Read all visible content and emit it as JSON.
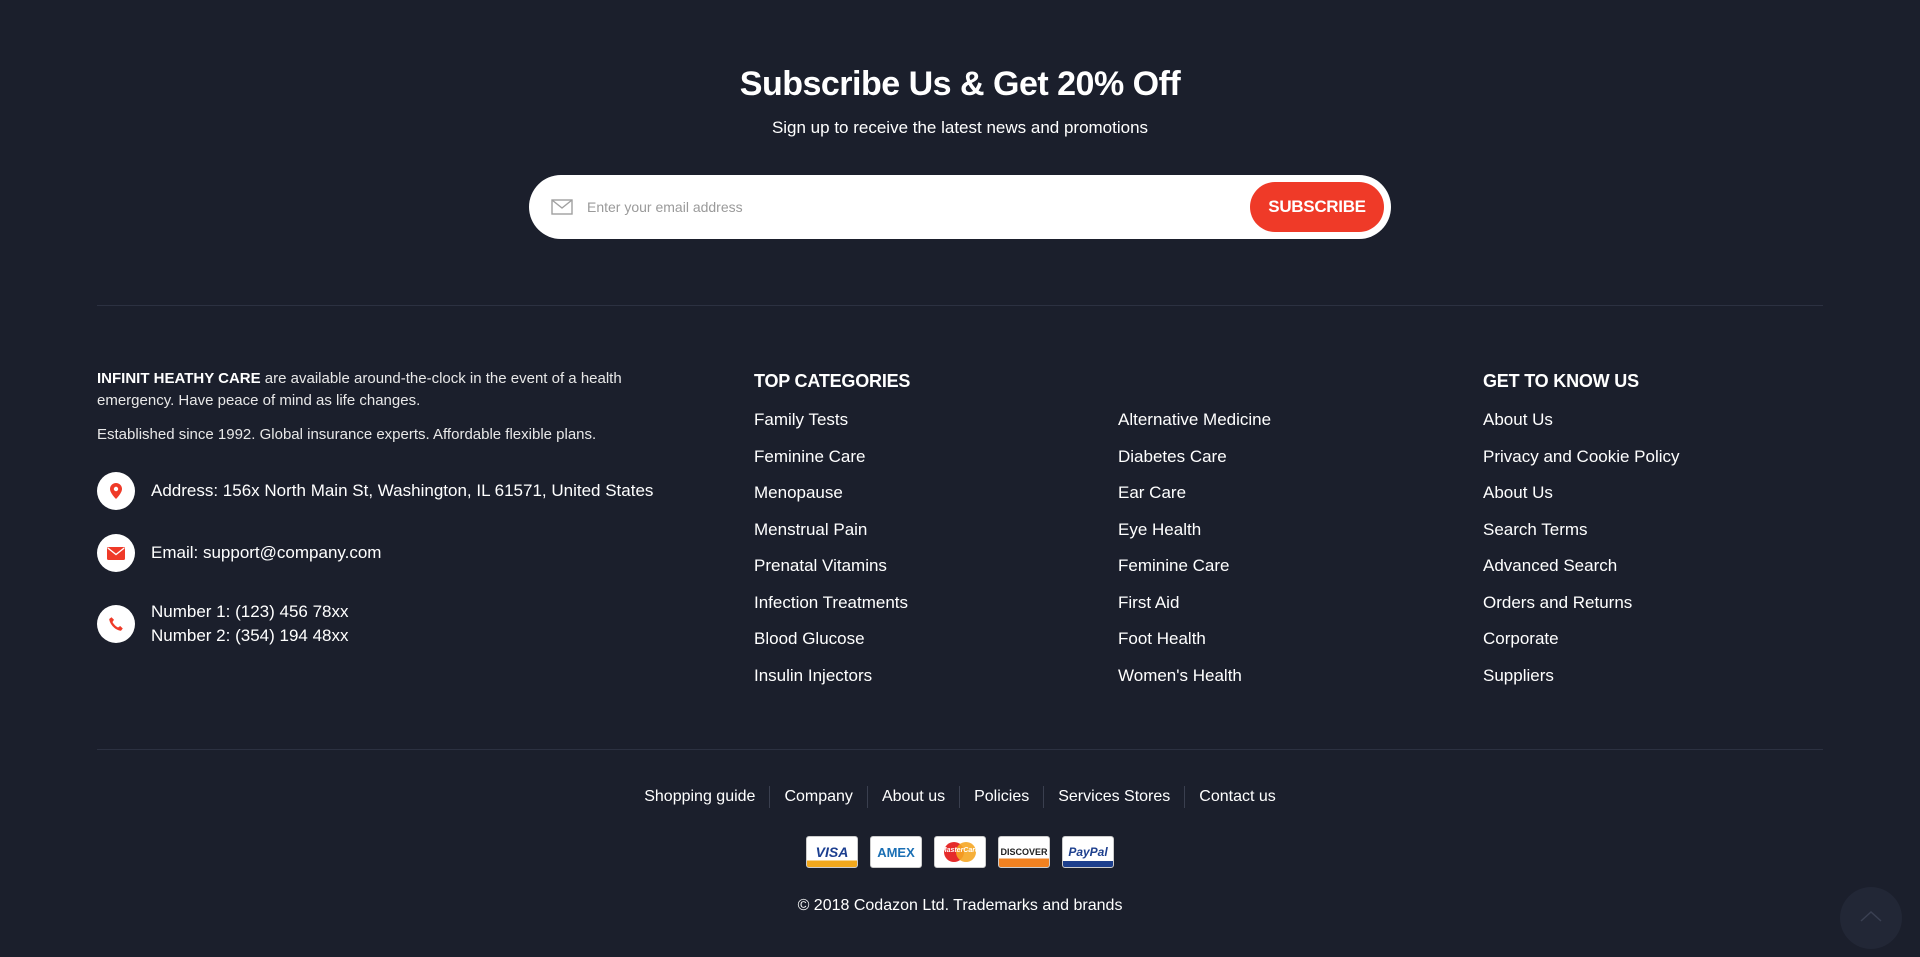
{
  "subscribe": {
    "title": "Subscribe Us & Get 20% Off",
    "subtitle": "Sign up to receive the latest news and promotions",
    "placeholder": "Enter your email address",
    "button": "SUBSCRIBE"
  },
  "about": {
    "brand": "INFINIT HEATHY CARE",
    "intro": " are available around-the-clock in the event of a health emergency. Have peace of mind as life changes.",
    "established": "Established since 1992. Global insurance experts. Affordable flexible plans."
  },
  "contact": {
    "address": "Address: 156x North Main St, Washington, IL 61571, United States",
    "email": "Email: support@company.com",
    "phone1": "Number 1: (123) 456 78xx",
    "phone2": "Number 2: (354) 194 48xx"
  },
  "top_categories": {
    "title": "TOP CATEGORIES",
    "col1": [
      "Family Tests",
      "Feminine Care",
      "Menopause",
      "Menstrual Pain",
      "Prenatal Vitamins",
      "Infection Treatments",
      "Blood Glucose",
      "Insulin Injectors"
    ],
    "col2": [
      "Alternative Medicine",
      "Diabetes Care",
      "Ear Care",
      "Eye Health",
      "Feminine Care",
      "First Aid",
      "Foot Health",
      "Women's Health"
    ]
  },
  "get_to_know": {
    "title": "GET TO KNOW US",
    "items": [
      "About Us",
      "Privacy and Cookie Policy",
      "About Us",
      "Search Terms",
      "Advanced Search",
      "Orders and Returns",
      "Corporate",
      "Suppliers"
    ]
  },
  "bottom_nav": [
    "Shopping guide",
    "Company",
    "About us",
    "Policies",
    "Services Stores",
    "Contact us"
  ],
  "payments": [
    "VISA",
    "AMEX",
    "MasterCard",
    "DISCOVER",
    "PayPal"
  ],
  "copyright": "© 2018 Codazon Ltd. Trademarks and brands",
  "colors": {
    "background": "#1b1f2c",
    "accent": "#ef3a28",
    "text": "#ffffff"
  },
  "icons": {
    "email_field": "envelope-icon",
    "address": "map-pin-icon",
    "email": "envelope-icon",
    "phone": "phone-icon",
    "back_to_top": "chevron-up-icon"
  }
}
